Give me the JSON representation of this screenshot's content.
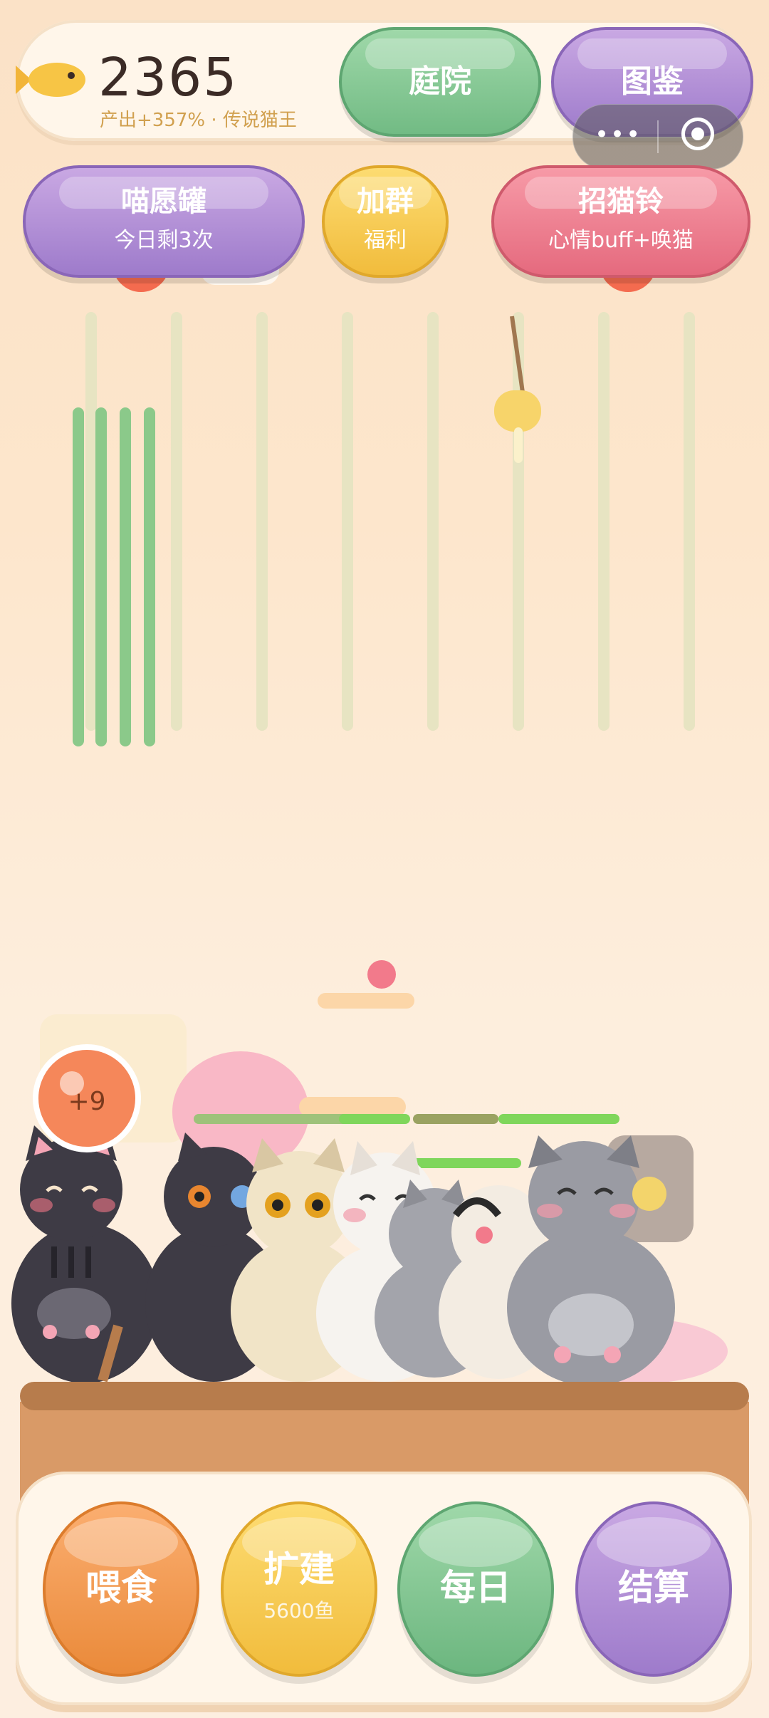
{
  "top_bar": {
    "fish_icon": "fish-icon",
    "fish_count": "2365",
    "subtitle": "产出+357% · 传说猫王",
    "yard_button": "庭院",
    "book_button": "图鉴"
  },
  "capsule": {
    "more_label": "•••",
    "close_icon": "target-icon"
  },
  "row2": {
    "wish": {
      "title": "喵愿罐",
      "sub": "今日剩3次"
    },
    "group": {
      "title": "加群",
      "sub": "福利"
    },
    "bell": {
      "title": "招猫铃",
      "sub": "心情buff+唤猫"
    }
  },
  "bubble": {
    "text": "+9"
  },
  "bottom": {
    "feed": "喂食",
    "build": "扩建",
    "build_cost": "5600鱼",
    "daily": "每日",
    "settle": "结算"
  },
  "colors": {
    "green": "#72bb84",
    "purple": "#9e7bcb",
    "yellow": "#f1bc3c",
    "pink": "#e56a7e",
    "orange": "#ea8a3a"
  }
}
